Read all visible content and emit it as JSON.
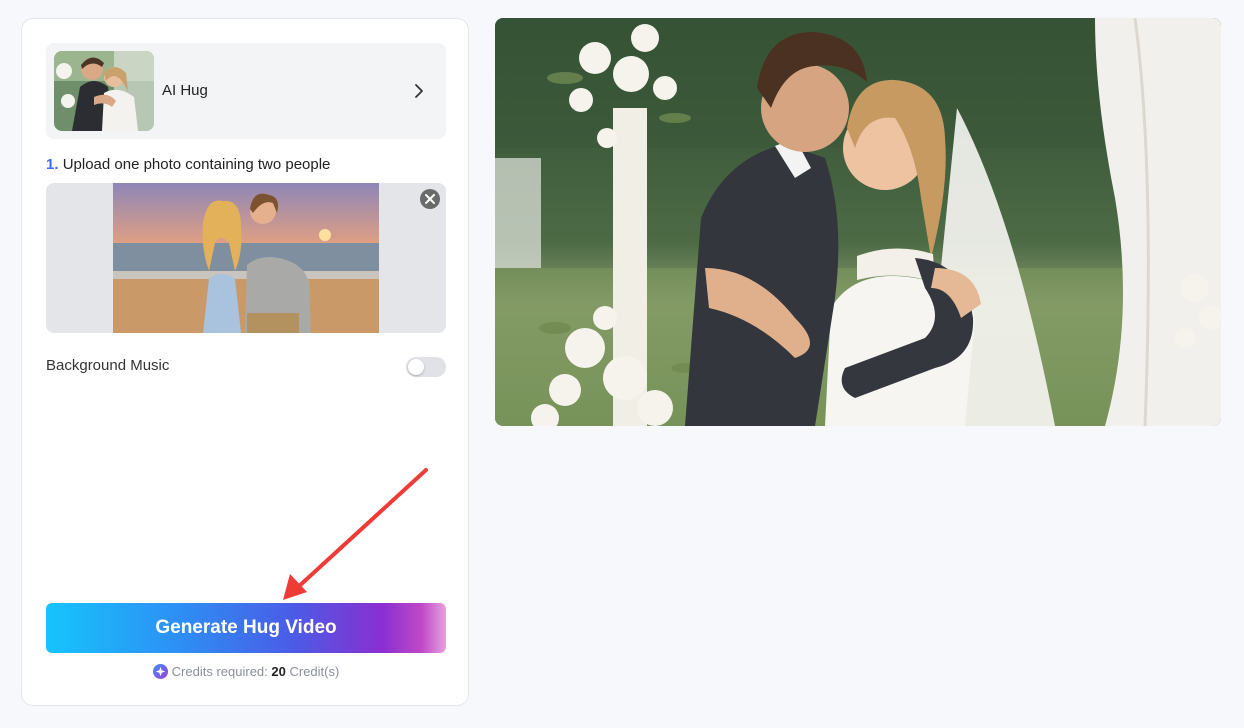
{
  "template": {
    "title": "AI Hug"
  },
  "upload": {
    "step_number": "1.",
    "step_text": "Upload one photo containing two people"
  },
  "settings": {
    "background_music_label": "Background Music",
    "background_music_enabled": false
  },
  "generate": {
    "button_label": "Generate Hug Video",
    "credits_prefix": "Credits required: ",
    "credits_amount": "20",
    "credits_suffix": " Credit(s)"
  },
  "colors": {
    "accent": "#3d6bf3",
    "button_gradient_start": "#16c4fb",
    "button_gradient_end": "#c04ac6",
    "annotation_arrow": "#ee3b36"
  },
  "icons": {
    "template_chevron": "chevron-right-icon",
    "remove_photo": "close-icon",
    "credits": "credit-star-icon"
  }
}
